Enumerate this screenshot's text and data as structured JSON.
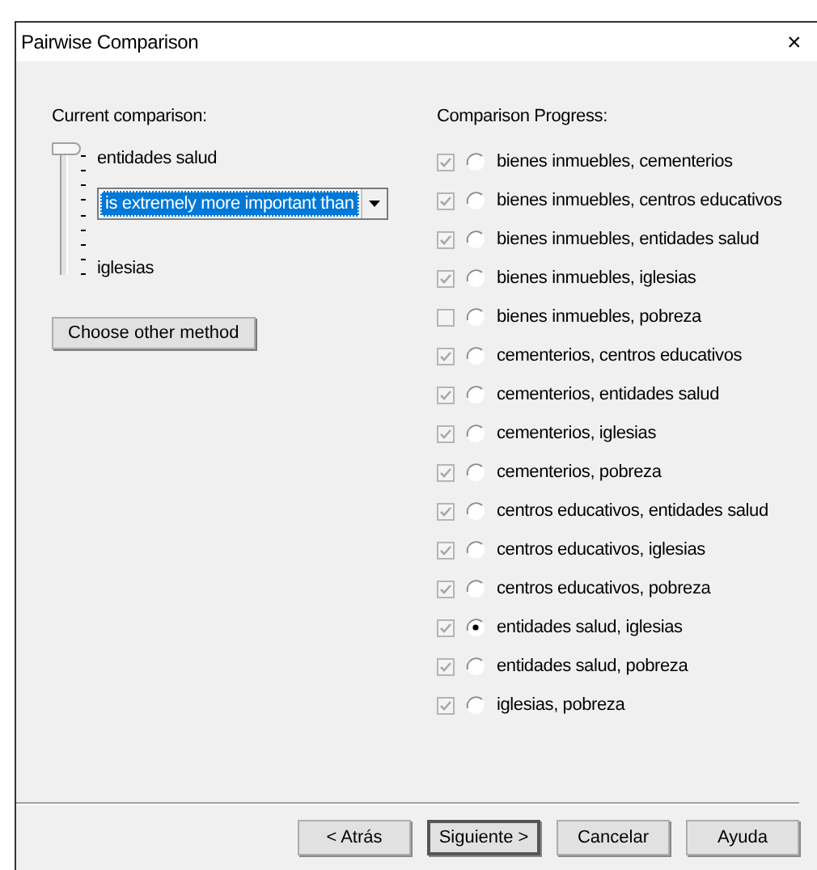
{
  "window": {
    "title": "Pairwise Comparison",
    "close": "×"
  },
  "current": {
    "label": "Current comparison:",
    "top_item": "entidades salud",
    "bottom_item": "iglesias",
    "slider": {
      "level": 1
    },
    "relation": {
      "value": "is extremely more important than"
    },
    "method_button": "Choose other method"
  },
  "progress": {
    "label": "Comparison Progress:",
    "items": [
      {
        "text": "bienes inmuebles, cementerios",
        "checked": true,
        "selected": false
      },
      {
        "text": "bienes inmuebles, centros educativos",
        "checked": true,
        "selected": false
      },
      {
        "text": "bienes inmuebles, entidades salud",
        "checked": true,
        "selected": false
      },
      {
        "text": "bienes inmuebles, iglesias",
        "checked": true,
        "selected": false
      },
      {
        "text": "bienes inmuebles, pobreza",
        "checked": false,
        "selected": false
      },
      {
        "text": "cementerios, centros educativos",
        "checked": true,
        "selected": false
      },
      {
        "text": "cementerios, entidades salud",
        "checked": true,
        "selected": false
      },
      {
        "text": "cementerios, iglesias",
        "checked": true,
        "selected": false
      },
      {
        "text": "cementerios, pobreza",
        "checked": true,
        "selected": false
      },
      {
        "text": "centros educativos, entidades salud",
        "checked": true,
        "selected": false
      },
      {
        "text": "centros educativos, iglesias",
        "checked": true,
        "selected": false
      },
      {
        "text": "centros educativos, pobreza",
        "checked": true,
        "selected": false
      },
      {
        "text": "entidades salud, iglesias",
        "checked": true,
        "selected": true
      },
      {
        "text": "entidades salud, pobreza",
        "checked": true,
        "selected": false
      },
      {
        "text": "iglesias, pobreza",
        "checked": true,
        "selected": false
      }
    ]
  },
  "buttons": [
    {
      "label": "< Atrás",
      "default": false
    },
    {
      "label": "Siguiente >",
      "default": true
    },
    {
      "label": "Cancelar",
      "default": false
    },
    {
      "label": "Ayuda",
      "default": false
    }
  ]
}
